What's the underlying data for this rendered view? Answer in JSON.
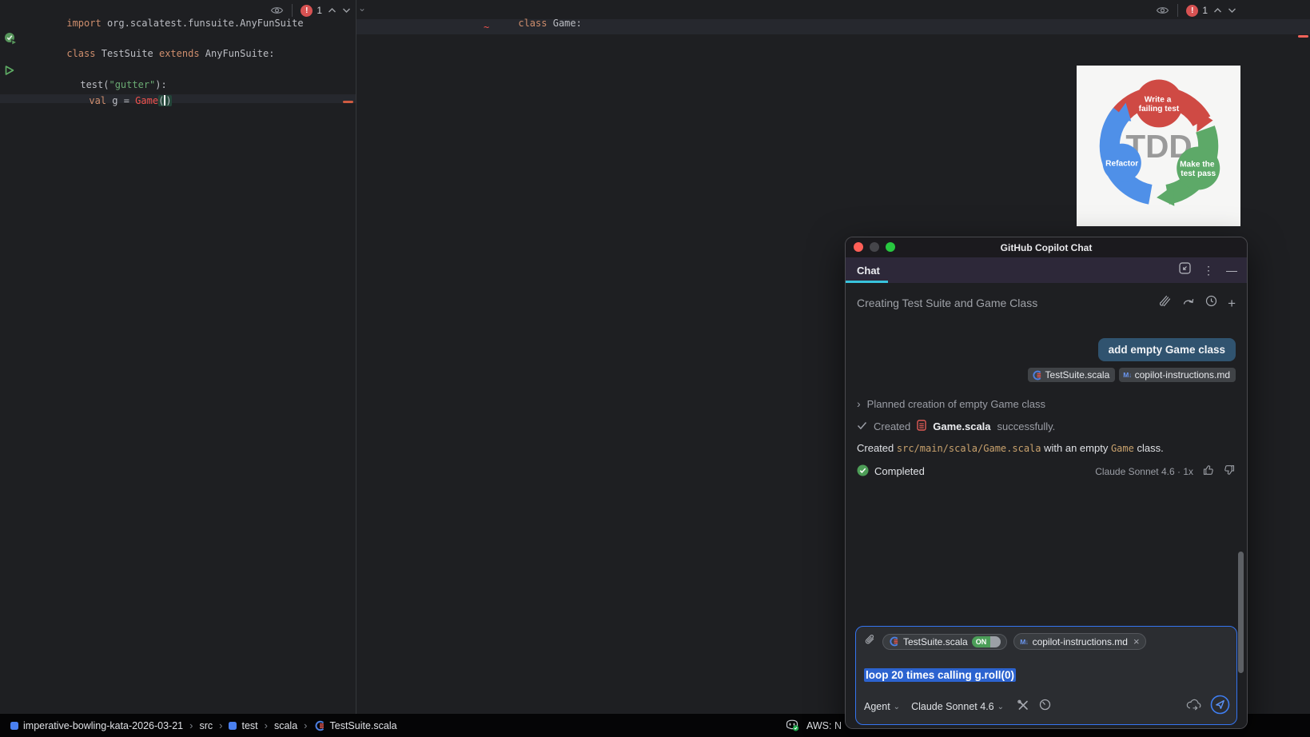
{
  "icons": {
    "exclaim": "!",
    "kebab": "⋮",
    "minimize": "—",
    "plus": "+",
    "close": "×",
    "markdown": "M↓",
    "crumb_sep": "›",
    "step_chevron": "›",
    "fold_chevron": "⌄",
    "dropdown_chevron": "⌄"
  },
  "editor_left": {
    "error_count": "1",
    "code": {
      "import_kw": "import ",
      "import_path": "org.scalatest.funsuite.AnyFunSuite",
      "class_kw": "class ",
      "class_name": "TestSuite ",
      "extends_kw": "extends ",
      "extends_name": "AnyFunSuite:",
      "test_call": "test(",
      "test_string": "\"gutter\"",
      "test_close": "):",
      "val_kw": "val ",
      "val_expr": "g = ",
      "ctor_ref": "Game",
      "paren_open": "(",
      "paren_close": ")"
    }
  },
  "editor_right": {
    "error_count": "1",
    "code": {
      "class_kw": "class ",
      "class_name": "Game:",
      "tilde": "~"
    }
  },
  "tdd": {
    "center": "TDD",
    "top_line1": "Write a",
    "top_line2": "failing test",
    "right_line1": "Make the",
    "right_line2": "test pass",
    "left_label": "Refactor",
    "red": "#cf4a44",
    "green": "#5da968",
    "blue": "#4f90e8"
  },
  "chat": {
    "window_title": "GitHub Copilot Chat",
    "tab_label": "Chat",
    "thread_title": "Creating Test Suite and Game Class",
    "user_message": "add empty Game class",
    "context_chips": [
      "TestSuite.scala",
      "copilot-instructions.md"
    ],
    "planned_step": "Planned creation of empty Game class",
    "created_label": "Created",
    "created_file": "Game.scala",
    "created_suffix": "successfully.",
    "result_text1": "Created ",
    "result_code1": "src/main/scala/Game.scala",
    "result_text2": " with an empty ",
    "result_code2": "Game",
    "result_text3": " class.",
    "completed_label": "Completed",
    "model_info": "Claude Sonnet 4.6 · 1x",
    "input": {
      "chip1": "TestSuite.scala",
      "chip1_toggle": "ON",
      "chip2": "copilot-instructions.md",
      "message": "loop 20 times calling g.roll(0)",
      "mode": "Agent",
      "model": "Claude Sonnet 4.6"
    }
  },
  "status_bar": {
    "crumb_project": "imperative-bowling-kata-2026-03-21",
    "crumb_src": "src",
    "crumb_test": "test",
    "crumb_scala": "scala",
    "crumb_file": "TestSuite.scala",
    "aws_label": "AWS: N"
  }
}
